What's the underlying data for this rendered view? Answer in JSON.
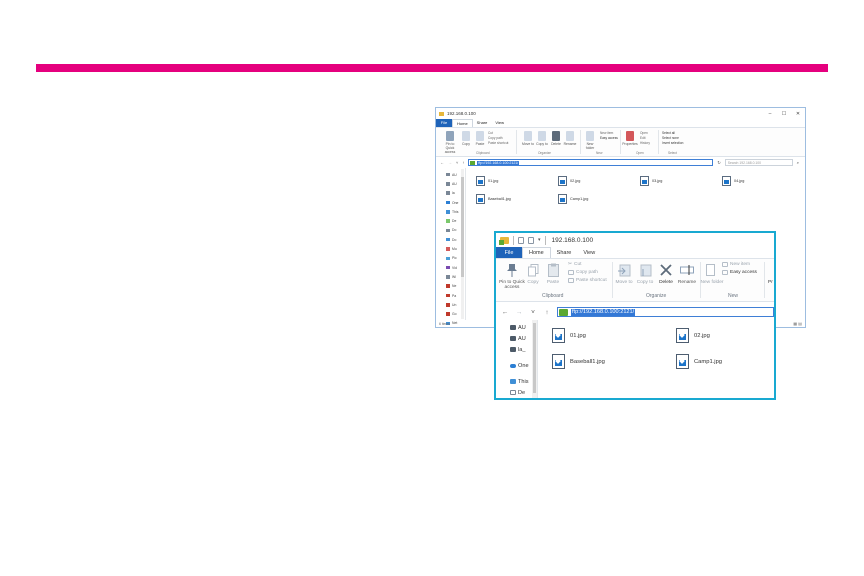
{
  "small_window": {
    "title": "192.168.0.100",
    "tabs": [
      "File",
      "Home",
      "Share",
      "View"
    ],
    "ribbon": {
      "pin": "Pin to Quick access",
      "copy": "Copy",
      "paste": "Paste",
      "cut": "Cut",
      "copy_path": "Copy path",
      "paste_shortcut": "Paste shortcut",
      "move_to": "Move to",
      "copy_to": "Copy to",
      "delete": "Delete",
      "rename": "Rename",
      "new_folder": "New folder",
      "new_item": "New item",
      "easy_access": "Easy access",
      "properties": "Properties",
      "open": "Open",
      "edit": "Edit",
      "history": "History",
      "select_all": "Select all",
      "select_none": "Select none",
      "invert_selection": "Invert selection",
      "groups": [
        "Clipboard",
        "Organize",
        "New",
        "Open",
        "Select"
      ]
    },
    "address": "ftp://192.168.0.100:2121/",
    "search_placeholder": "Search 192.168.0.100",
    "nav": [
      "AU",
      "AU",
      "la",
      "One",
      "This",
      "De",
      "Do",
      "Do",
      "Mu",
      "Pic",
      "Vid",
      "Wi",
      "Ne",
      "Pa",
      "Un",
      "Go",
      "Net"
    ],
    "files": [
      "01.jpg",
      "02.jpg",
      "03.jpg",
      "04.jpg",
      "Baseball1.jpg",
      "Camp1.jpg"
    ],
    "status": "6 items",
    "controls": [
      "–",
      "☐",
      "✕"
    ]
  },
  "zoom_window": {
    "title": "192.168.0.100",
    "tabs": [
      "File",
      "Home",
      "Share",
      "View"
    ],
    "ribbon": {
      "pin": "Pin to Quick access",
      "copy": "Copy",
      "paste": "Paste",
      "cut": "Cut",
      "copy_path": "Copy path",
      "paste_shortcut": "Paste shortcut",
      "move_to": "Move to",
      "copy_to": "Copy to",
      "delete": "Delete",
      "rename": "Rename",
      "new_folder": "New folder",
      "new_item": "New item",
      "easy_access": "Easy access",
      "properties_partial": "Pr",
      "groups": [
        "Clipboard",
        "Organize",
        "New"
      ]
    },
    "address": "ftp://192.168.0.100:2121/",
    "nav": [
      "AU",
      "AU",
      "la_",
      "One",
      "This",
      "De"
    ],
    "files": [
      "01.jpg",
      "02.jpg",
      "Baseball1.jpg",
      "Camp1.jpg"
    ]
  },
  "colors": {
    "accent_bar": "#e5007e",
    "zoom_border": "#19a9d1",
    "file_tab": "#1e63b9"
  }
}
